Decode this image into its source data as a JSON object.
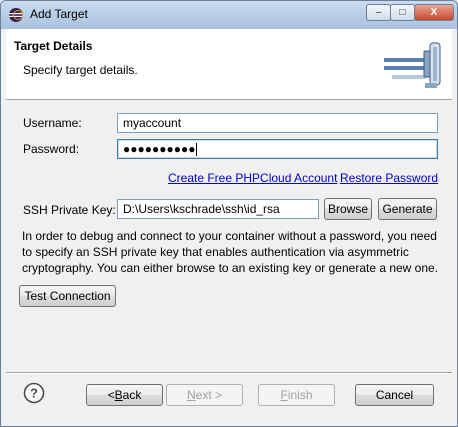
{
  "window": {
    "title": "Add Target",
    "minimize_glyph": "–",
    "maximize_glyph": "□",
    "close_glyph": "X"
  },
  "header": {
    "title": "Target Details",
    "subtitle": "Specify target details."
  },
  "form": {
    "username_label": "Username:",
    "username_value": "myaccount",
    "password_label": "Password:",
    "password_mask": "●●●●●●●●●●",
    "create_account_link": "Create Free PHPCloud Account",
    "restore_password_link": "Restore Password",
    "ssh_key_label": "SSH Private Key:",
    "ssh_key_value": "D:\\Users\\kschrade\\ssh\\id_rsa",
    "browse_button": "Browse",
    "generate_button": "Generate",
    "description": "In order to debug and connect to your container without a password, you need to specify an SSH private key that enables authentication via asymmetric cryptography. You can either browse to an existing key or generate a new one.",
    "test_connection_button": "Test Connection"
  },
  "footer": {
    "back_prefix": "< ",
    "back_mnemonic": "B",
    "back_rest": "ack",
    "next_mnemonic": "N",
    "next_rest": "ext >",
    "finish_mnemonic": "F",
    "finish_rest": "inish",
    "cancel_button": "Cancel"
  },
  "colors": {
    "link": "#0000cc",
    "header_bg": "#ffffff",
    "dialog_bg": "#f0f0f0"
  },
  "icons": [
    "eclipse-app-icon",
    "connector-banner-icon",
    "help-icon"
  ]
}
